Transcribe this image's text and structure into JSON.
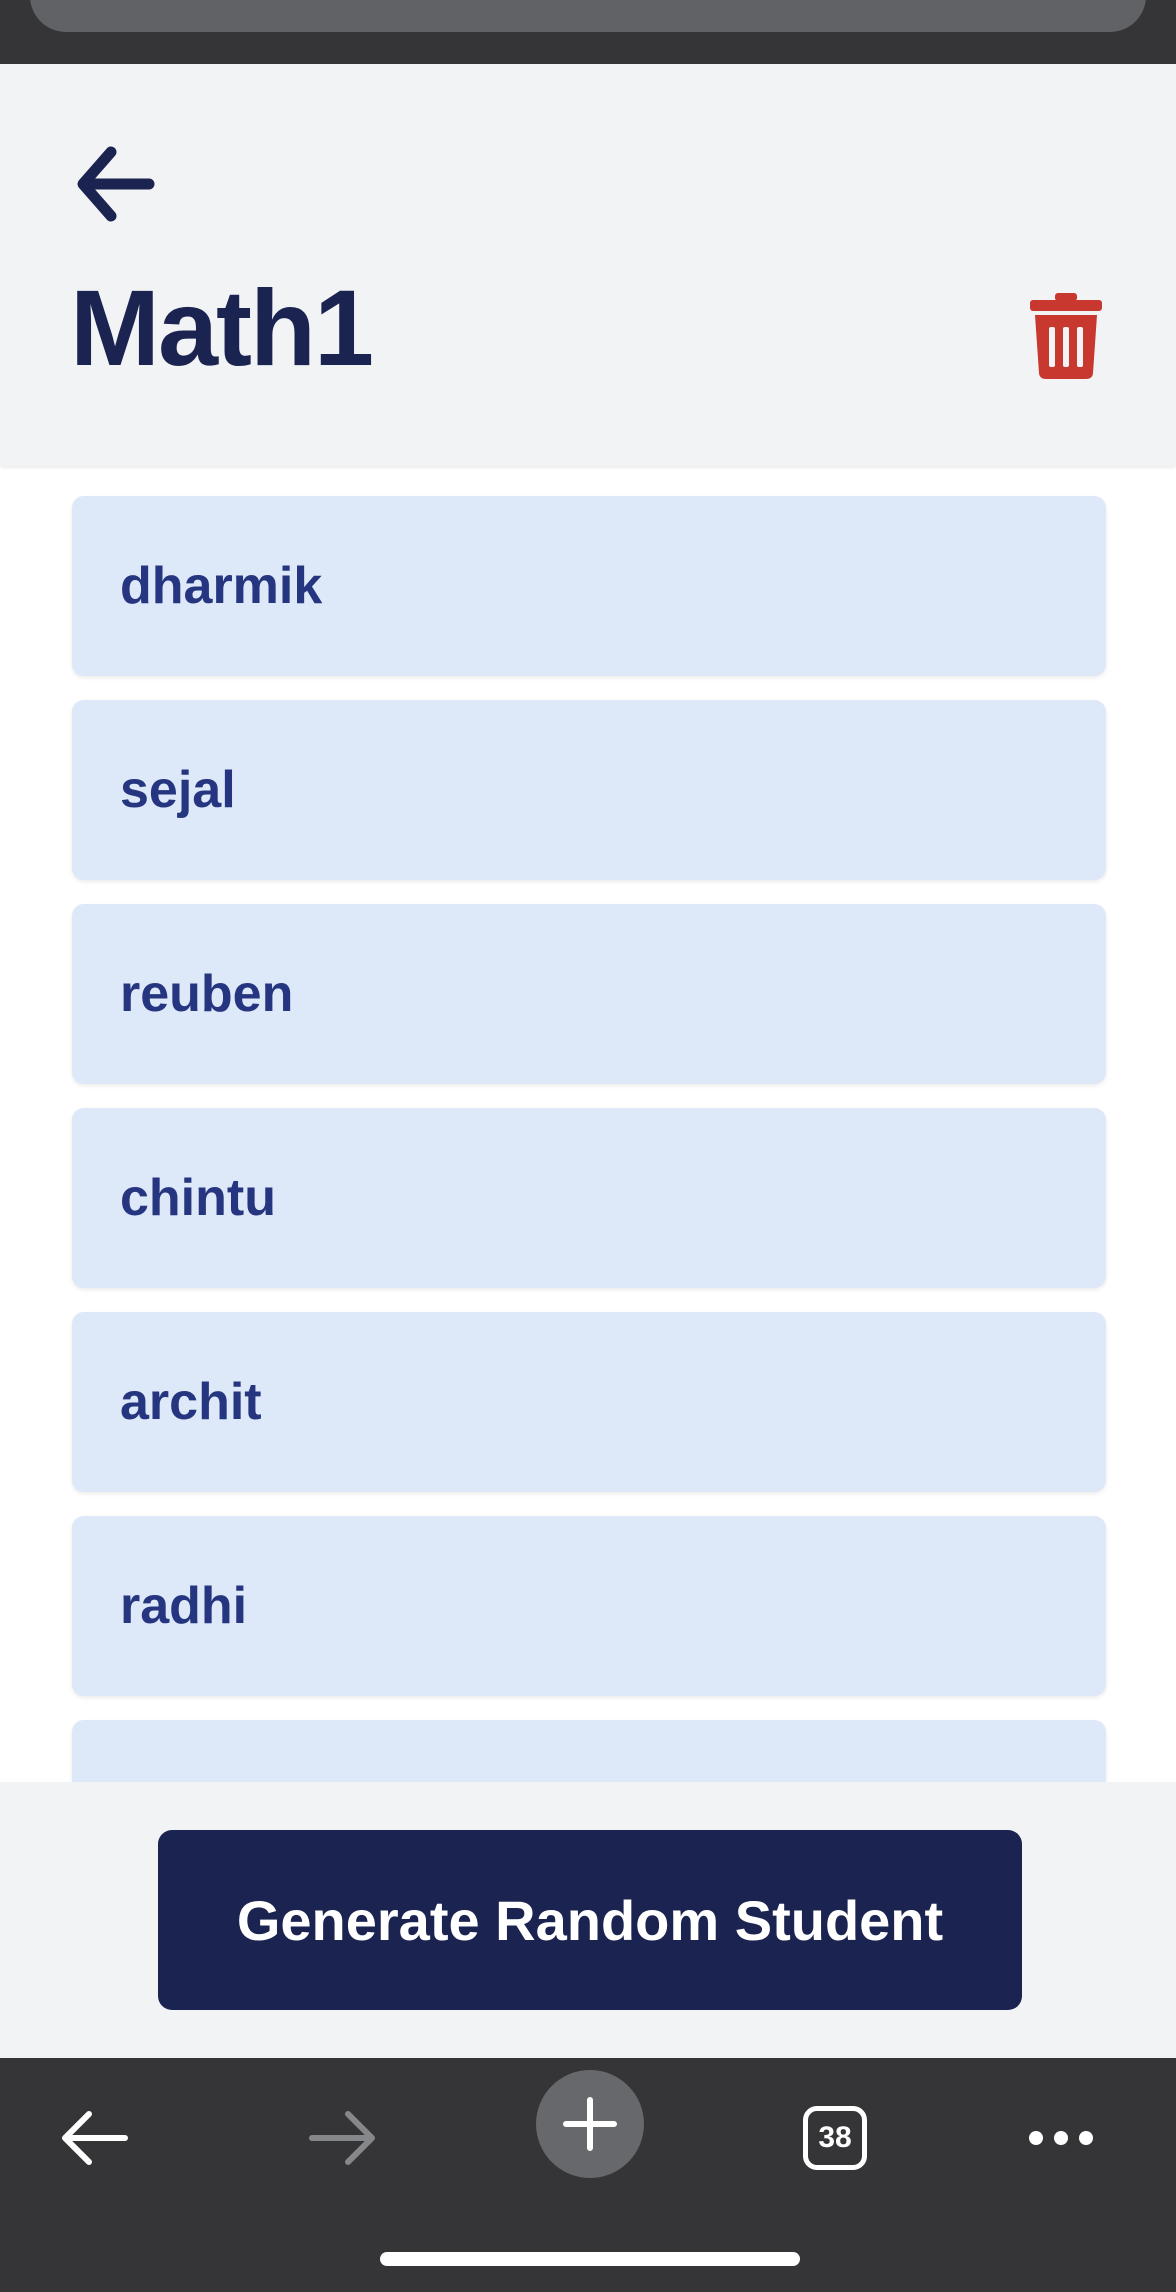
{
  "header": {
    "title": "Math1",
    "back_icon": "arrow-left-icon",
    "delete_icon": "trash-icon"
  },
  "students": [
    {
      "name": "dharmik"
    },
    {
      "name": "sejal"
    },
    {
      "name": "reuben"
    },
    {
      "name": "chintu"
    },
    {
      "name": "archit"
    },
    {
      "name": "radhi"
    },
    {
      "name": ""
    }
  ],
  "actions": {
    "generate_label": "Generate Random Student"
  },
  "browser_toolbar": {
    "tab_count": "38",
    "icons": [
      "arrow-left-icon",
      "arrow-right-icon",
      "plus-icon",
      "tabs-icon",
      "more-icon"
    ]
  },
  "colors": {
    "primary": "#1b2350",
    "card_background": "#dde8f8",
    "card_text": "#263580",
    "danger": "#c8382e",
    "header_background": "#f2f3f5",
    "chrome": "#353537"
  }
}
